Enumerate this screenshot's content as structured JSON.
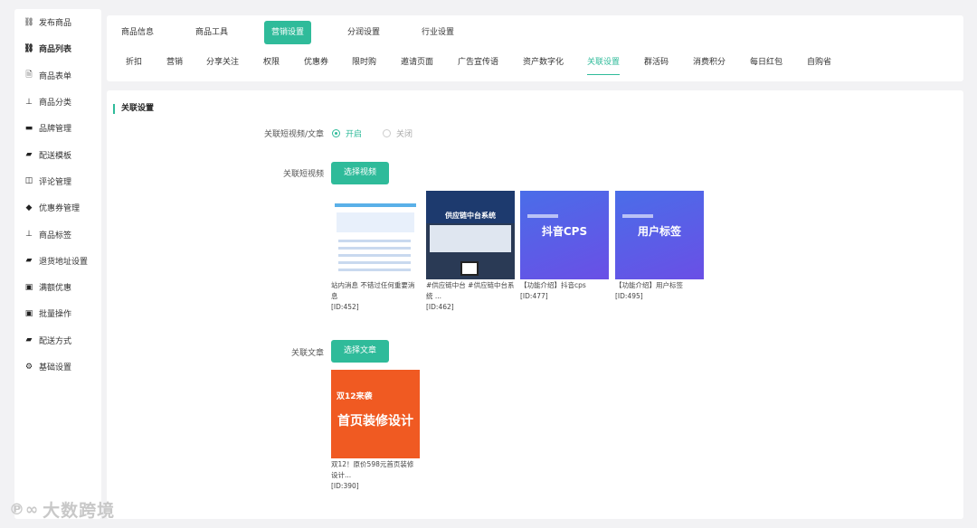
{
  "sidebar": {
    "items": [
      {
        "label": "发布商品",
        "icon": "link-icon",
        "glyph": "⛓",
        "active": false
      },
      {
        "label": "商品列表",
        "icon": "link-icon",
        "glyph": "⛓",
        "active": true
      },
      {
        "label": "商品表单",
        "icon": "document-icon",
        "glyph": "🗎",
        "active": false
      },
      {
        "label": "商品分类",
        "icon": "hierarchy-icon",
        "glyph": "⊥",
        "active": false
      },
      {
        "label": "品牌管理",
        "icon": "briefcase-icon",
        "glyph": "▬",
        "active": false
      },
      {
        "label": "配送模板",
        "icon": "truck-icon",
        "glyph": "▰",
        "active": false
      },
      {
        "label": "评论管理",
        "icon": "columns-icon",
        "glyph": "◫",
        "active": false
      },
      {
        "label": "优惠券管理",
        "icon": "tag-icon",
        "glyph": "◆",
        "active": false
      },
      {
        "label": "商品标签",
        "icon": "hierarchy-icon",
        "glyph": "⊥",
        "active": false
      },
      {
        "label": "退货地址设置",
        "icon": "truck-icon",
        "glyph": "▰",
        "active": false
      },
      {
        "label": "满额优惠",
        "icon": "gift-icon",
        "glyph": "▣",
        "active": false
      },
      {
        "label": "批量操作",
        "icon": "gift-icon",
        "glyph": "▣",
        "active": false
      },
      {
        "label": "配送方式",
        "icon": "truck-icon",
        "glyph": "▰",
        "active": false
      },
      {
        "label": "基础设置",
        "icon": "gear-icon",
        "glyph": "⚙",
        "active": false
      }
    ]
  },
  "tabs": [
    {
      "label": "商品信息",
      "active": false
    },
    {
      "label": "商品工具",
      "active": false
    },
    {
      "label": "营销设置",
      "active": true
    },
    {
      "label": "分润设置",
      "active": false
    },
    {
      "label": "行业设置",
      "active": false
    }
  ],
  "subtabs": [
    {
      "label": "折扣",
      "active": false
    },
    {
      "label": "营销",
      "active": false
    },
    {
      "label": "分享关注",
      "active": false
    },
    {
      "label": "权限",
      "active": false
    },
    {
      "label": "优惠券",
      "active": false
    },
    {
      "label": "限时购",
      "active": false
    },
    {
      "label": "邀请页面",
      "active": false
    },
    {
      "label": "广告宣传语",
      "active": false
    },
    {
      "label": "资产数字化",
      "active": false
    },
    {
      "label": "关联设置",
      "active": true
    },
    {
      "label": "群活码",
      "active": false
    },
    {
      "label": "消费积分",
      "active": false
    },
    {
      "label": "每日红包",
      "active": false
    },
    {
      "label": "自购省",
      "active": false
    }
  ],
  "section_title": "关联设置",
  "form": {
    "toggle_label": "关联短视频/文章",
    "toggle_on": "开启",
    "toggle_off": "关闭",
    "toggle_value": "开启",
    "video_label": "关联短视频",
    "video_button": "选择视频",
    "article_label": "关联文章",
    "article_button": "选择文章"
  },
  "videos": [
    {
      "caption": "站内消息 不错过任何重要消息",
      "id": "[ID:452]",
      "thumb_text": ""
    },
    {
      "caption": "#供应链中台 #供应链中台系统 ...",
      "id": "[ID:462]",
      "thumb_text": "供应链中台系统"
    },
    {
      "caption": "【功能介绍】抖音cps",
      "id": "[ID:477]",
      "thumb_text": "抖音CPS"
    },
    {
      "caption": "【功能介绍】用户标签",
      "id": "[ID:495]",
      "thumb_text": "用户标签"
    }
  ],
  "articles": [
    {
      "caption": "双12！原价598元首页装修设计...",
      "id": "[ID:390]",
      "thumb_text": "首页装修设计",
      "thumb_small": "双12来袭"
    }
  ],
  "close_glyph": "x",
  "watermark": {
    "logo": "℗∞",
    "text": "大数跨境"
  },
  "colors": {
    "accent": "#2fbb9a"
  }
}
